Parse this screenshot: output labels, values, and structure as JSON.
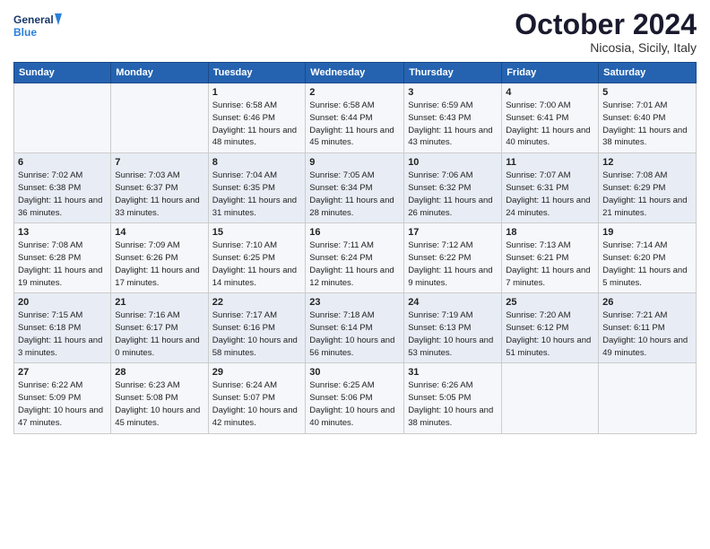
{
  "header": {
    "logo_line1": "General",
    "logo_line2": "Blue",
    "month": "October 2024",
    "location": "Nicosia, Sicily, Italy"
  },
  "weekdays": [
    "Sunday",
    "Monday",
    "Tuesday",
    "Wednesday",
    "Thursday",
    "Friday",
    "Saturday"
  ],
  "rows": [
    [
      {
        "day": "",
        "info": ""
      },
      {
        "day": "",
        "info": ""
      },
      {
        "day": "1",
        "info": "Sunrise: 6:58 AM\nSunset: 6:46 PM\nDaylight: 11 hours and 48 minutes."
      },
      {
        "day": "2",
        "info": "Sunrise: 6:58 AM\nSunset: 6:44 PM\nDaylight: 11 hours and 45 minutes."
      },
      {
        "day": "3",
        "info": "Sunrise: 6:59 AM\nSunset: 6:43 PM\nDaylight: 11 hours and 43 minutes."
      },
      {
        "day": "4",
        "info": "Sunrise: 7:00 AM\nSunset: 6:41 PM\nDaylight: 11 hours and 40 minutes."
      },
      {
        "day": "5",
        "info": "Sunrise: 7:01 AM\nSunset: 6:40 PM\nDaylight: 11 hours and 38 minutes."
      }
    ],
    [
      {
        "day": "6",
        "info": "Sunrise: 7:02 AM\nSunset: 6:38 PM\nDaylight: 11 hours and 36 minutes."
      },
      {
        "day": "7",
        "info": "Sunrise: 7:03 AM\nSunset: 6:37 PM\nDaylight: 11 hours and 33 minutes."
      },
      {
        "day": "8",
        "info": "Sunrise: 7:04 AM\nSunset: 6:35 PM\nDaylight: 11 hours and 31 minutes."
      },
      {
        "day": "9",
        "info": "Sunrise: 7:05 AM\nSunset: 6:34 PM\nDaylight: 11 hours and 28 minutes."
      },
      {
        "day": "10",
        "info": "Sunrise: 7:06 AM\nSunset: 6:32 PM\nDaylight: 11 hours and 26 minutes."
      },
      {
        "day": "11",
        "info": "Sunrise: 7:07 AM\nSunset: 6:31 PM\nDaylight: 11 hours and 24 minutes."
      },
      {
        "day": "12",
        "info": "Sunrise: 7:08 AM\nSunset: 6:29 PM\nDaylight: 11 hours and 21 minutes."
      }
    ],
    [
      {
        "day": "13",
        "info": "Sunrise: 7:08 AM\nSunset: 6:28 PM\nDaylight: 11 hours and 19 minutes."
      },
      {
        "day": "14",
        "info": "Sunrise: 7:09 AM\nSunset: 6:26 PM\nDaylight: 11 hours and 17 minutes."
      },
      {
        "day": "15",
        "info": "Sunrise: 7:10 AM\nSunset: 6:25 PM\nDaylight: 11 hours and 14 minutes."
      },
      {
        "day": "16",
        "info": "Sunrise: 7:11 AM\nSunset: 6:24 PM\nDaylight: 11 hours and 12 minutes."
      },
      {
        "day": "17",
        "info": "Sunrise: 7:12 AM\nSunset: 6:22 PM\nDaylight: 11 hours and 9 minutes."
      },
      {
        "day": "18",
        "info": "Sunrise: 7:13 AM\nSunset: 6:21 PM\nDaylight: 11 hours and 7 minutes."
      },
      {
        "day": "19",
        "info": "Sunrise: 7:14 AM\nSunset: 6:20 PM\nDaylight: 11 hours and 5 minutes."
      }
    ],
    [
      {
        "day": "20",
        "info": "Sunrise: 7:15 AM\nSunset: 6:18 PM\nDaylight: 11 hours and 3 minutes."
      },
      {
        "day": "21",
        "info": "Sunrise: 7:16 AM\nSunset: 6:17 PM\nDaylight: 11 hours and 0 minutes."
      },
      {
        "day": "22",
        "info": "Sunrise: 7:17 AM\nSunset: 6:16 PM\nDaylight: 10 hours and 58 minutes."
      },
      {
        "day": "23",
        "info": "Sunrise: 7:18 AM\nSunset: 6:14 PM\nDaylight: 10 hours and 56 minutes."
      },
      {
        "day": "24",
        "info": "Sunrise: 7:19 AM\nSunset: 6:13 PM\nDaylight: 10 hours and 53 minutes."
      },
      {
        "day": "25",
        "info": "Sunrise: 7:20 AM\nSunset: 6:12 PM\nDaylight: 10 hours and 51 minutes."
      },
      {
        "day": "26",
        "info": "Sunrise: 7:21 AM\nSunset: 6:11 PM\nDaylight: 10 hours and 49 minutes."
      }
    ],
    [
      {
        "day": "27",
        "info": "Sunrise: 6:22 AM\nSunset: 5:09 PM\nDaylight: 10 hours and 47 minutes."
      },
      {
        "day": "28",
        "info": "Sunrise: 6:23 AM\nSunset: 5:08 PM\nDaylight: 10 hours and 45 minutes."
      },
      {
        "day": "29",
        "info": "Sunrise: 6:24 AM\nSunset: 5:07 PM\nDaylight: 10 hours and 42 minutes."
      },
      {
        "day": "30",
        "info": "Sunrise: 6:25 AM\nSunset: 5:06 PM\nDaylight: 10 hours and 40 minutes."
      },
      {
        "day": "31",
        "info": "Sunrise: 6:26 AM\nSunset: 5:05 PM\nDaylight: 10 hours and 38 minutes."
      },
      {
        "day": "",
        "info": ""
      },
      {
        "day": "",
        "info": ""
      }
    ]
  ]
}
